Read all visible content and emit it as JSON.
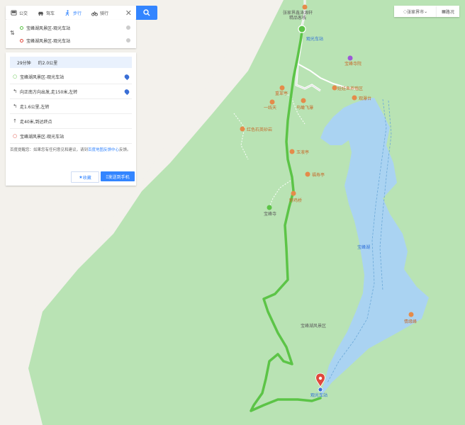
{
  "modes": [
    {
      "label": "公交",
      "icon": "bus-icon"
    },
    {
      "label": "驾车",
      "icon": "car-icon"
    },
    {
      "label": "步行",
      "icon": "walk-icon",
      "active": true
    },
    {
      "label": "骑行",
      "icon": "bike-icon"
    }
  ],
  "route": {
    "start": "宝峰湖风景区-观光车站",
    "end": "宝峰湖风景区-观光车站"
  },
  "summary": {
    "time": "29分钟",
    "distance": "约2.0公里"
  },
  "steps": [
    {
      "text": "宝峰湖风景区-观光车站",
      "icon": "start-circle-icon",
      "pin": true
    },
    {
      "text": "向正南方向出发,走150米,左转",
      "icon": "turn-left-icon",
      "pin": true
    },
    {
      "text": "走1.6公里,左转",
      "icon": "turn-left-icon",
      "pin": false
    },
    {
      "text": "走40米,到达终点",
      "icon": "straight-arrow-icon",
      "pin": false
    },
    {
      "text": "宝峰湖风景区-观光车站",
      "icon": "end-circle-icon",
      "pin": false
    }
  ],
  "note": {
    "prefix": "百度提醒您：如果您有任何意见和建议，请到",
    "link": "百度地图反馈中心",
    "suffix": "反馈。"
  },
  "buttons": {
    "favorite": "收藏",
    "send": "发送到手机"
  },
  "controls": {
    "city": "张家界市",
    "traffic": "路况"
  },
  "map_labels": {
    "top_poi": "张家界鑫涛源轩精品客栈",
    "start_station": "观光车站",
    "baofeng_temple": "宝峰寺院",
    "ridge": "重翠亭",
    "hotel": "娃娃鱼养殖区",
    "line1": "一线天",
    "feipu": "鸟瞰飞瀑",
    "dam_view": "观瀑台",
    "red_rock": "红色石英砂岩",
    "yu_lu_ting": "玉液亭",
    "fu_ting": "福寿亭",
    "ye_ji_qiao": "野鸡桥",
    "baofeng_temple2": "宝峰寺",
    "lake_road": "宝峰湖",
    "area_name": "宝峰湖风景区",
    "duanyan": "情缘峰",
    "end_station": "观光车站"
  },
  "colors": {
    "route": "#5cc447",
    "water": "#aad3f2",
    "forest": "#b5e2b0",
    "accent": "#3385ff"
  }
}
